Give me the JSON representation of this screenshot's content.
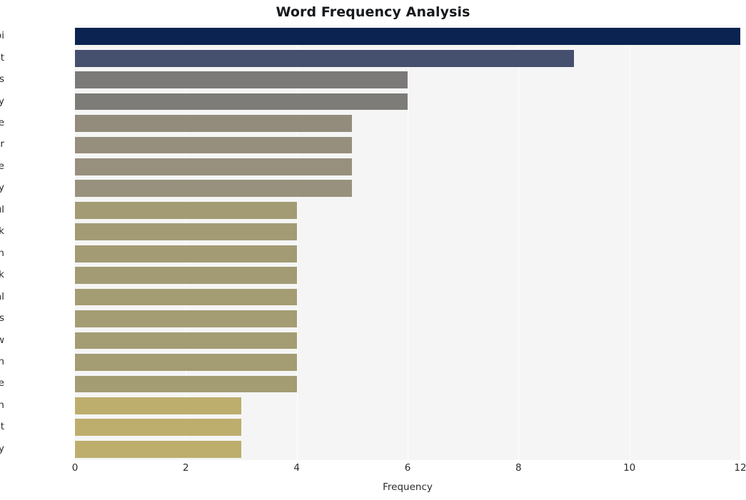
{
  "chart_data": {
    "type": "bar",
    "orientation": "horizontal",
    "title": "Word Frequency Analysis",
    "xlabel": "Frequency",
    "ylabel": "",
    "xlim": [
      0,
      12
    ],
    "ylim": null,
    "grid": true,
    "legend": null,
    "xticks": [
      "0",
      "2",
      "4",
      "6",
      "8",
      "10",
      "12"
    ],
    "xtick_values": [
      0,
      2,
      4,
      6,
      8,
      10,
      12
    ],
    "categories": [
      "fbi",
      "government",
      "backdoors",
      "agency",
      "surveillance",
      "backdoor",
      "intelligence",
      "spy",
      "powerful",
      "tiktok",
      "ban",
      "sputnik",
      "international",
      "agencies",
      "know",
      "tech",
      "chinese",
      "panopticon",
      "attempt",
      "activity"
    ],
    "values": [
      12,
      9,
      6,
      6,
      5,
      5,
      5,
      5,
      4,
      4,
      4,
      4,
      4,
      4,
      4,
      4,
      4,
      3,
      3,
      3
    ],
    "bar_colors": [
      "#0a2350",
      "#454f6e",
      "#7b7a79",
      "#7d7c78",
      "#938c7c",
      "#968f7d",
      "#97907d",
      "#98917d",
      "#a39b74",
      "#a39b74",
      "#a39b74",
      "#a39b74",
      "#a49c73",
      "#a49c73",
      "#a49c73",
      "#a49c73",
      "#a49c73",
      "#bdae6e",
      "#bdae6e",
      "#bdae6e"
    ],
    "plot_background": "#f5f5f5",
    "figure_background": "#ffffff",
    "gridline_color": "#ffffff"
  }
}
